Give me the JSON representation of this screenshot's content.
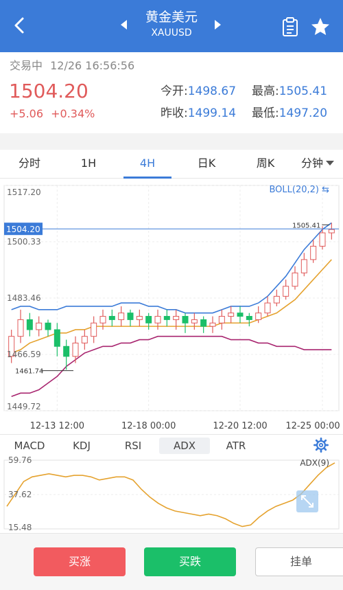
{
  "header": {
    "title": "黄金美元",
    "subtitle": "XAUUSD",
    "icons": [
      "back-icon",
      "prev-arrow-icon",
      "next-arrow-icon",
      "clipboard-icon",
      "star-icon"
    ]
  },
  "quote": {
    "status": "交易中",
    "datetime": "12/26 16:56:56",
    "price": "1504.20",
    "change": "+5.06",
    "change_pct": "+0.34%",
    "open_label": "今开:",
    "open": "1498.67",
    "high_label": "最高:",
    "high": "1505.41",
    "prev_close_label": "昨收:",
    "prev_close": "1499.14",
    "low_label": "最低:",
    "low": "1497.20"
  },
  "tabs": [
    "分时",
    "1H",
    "4H",
    "日K",
    "周K",
    "分钟"
  ],
  "active_tab": "4H",
  "indicator_tabs": [
    "MACD",
    "KDJ",
    "RSI",
    "ADX",
    "ATR"
  ],
  "active_indicator": "ADX",
  "buttons": {
    "buy_up": "买涨",
    "buy_down": "买跌",
    "order": "挂单"
  },
  "colors": {
    "brand": "#3b7bd8",
    "up": "#e05a5a",
    "down": "#1bbf69",
    "boll_mid": "#e5a22e",
    "boll_lower": "#a8256f"
  },
  "chart_data": [
    {
      "type": "candlestick",
      "indicator": "BOLL(20,2)",
      "y_ticks": [
        "1517.20",
        "1500.33",
        "1483.46",
        "1466.59",
        "1449.72"
      ],
      "ylim": [
        1449.72,
        1517.2
      ],
      "current_price_label": "1504.20",
      "high_marker": "1505.41",
      "low_marker": "1461.74",
      "x_ticks": [
        "12-13 12:00",
        "12-18 00:00",
        "12-20 12:00",
        "12-25 00:00"
      ],
      "candles": [
        [
          1466,
          1472,
          1464,
          1474
        ],
        [
          1472,
          1477,
          1470,
          1480
        ],
        [
          1477,
          1474,
          1472,
          1479
        ],
        [
          1474,
          1476,
          1472,
          1478
        ],
        [
          1476,
          1474,
          1472,
          1477
        ],
        [
          1474,
          1469,
          1466,
          1476
        ],
        [
          1469,
          1466,
          1462,
          1471
        ],
        [
          1466,
          1470,
          1464,
          1472
        ],
        [
          1470,
          1472,
          1468,
          1474
        ],
        [
          1472,
          1476,
          1470,
          1478
        ],
        [
          1476,
          1478,
          1474,
          1480
        ],
        [
          1478,
          1477,
          1475,
          1480
        ],
        [
          1477,
          1479,
          1475,
          1481
        ],
        [
          1479,
          1477,
          1475,
          1480
        ],
        [
          1477,
          1478,
          1475,
          1480
        ],
        [
          1478,
          1476,
          1474,
          1479
        ],
        [
          1476,
          1478,
          1474,
          1480
        ],
        [
          1478,
          1477,
          1475,
          1480
        ],
        [
          1477,
          1478,
          1474,
          1480
        ],
        [
          1478,
          1476,
          1473,
          1479
        ],
        [
          1476,
          1477,
          1474,
          1479
        ],
        [
          1477,
          1475,
          1473,
          1478
        ],
        [
          1475,
          1476,
          1473,
          1478
        ],
        [
          1476,
          1478,
          1474,
          1480
        ],
        [
          1478,
          1479,
          1476,
          1481
        ],
        [
          1479,
          1478,
          1476,
          1481
        ],
        [
          1478,
          1477,
          1475,
          1479
        ],
        [
          1477,
          1479,
          1476,
          1481
        ],
        [
          1479,
          1482,
          1478,
          1484
        ],
        [
          1482,
          1484,
          1481,
          1486
        ],
        [
          1484,
          1487,
          1483,
          1489
        ],
        [
          1487,
          1491,
          1486,
          1493
        ],
        [
          1491,
          1495,
          1490,
          1497
        ],
        [
          1495,
          1499,
          1494,
          1501
        ],
        [
          1499,
          1503,
          1498,
          1505
        ],
        [
          1503,
          1504,
          1501,
          1506
        ]
      ],
      "boll_upper": [
        1480,
        1481,
        1481,
        1480,
        1480,
        1480,
        1481,
        1481,
        1481,
        1481,
        1481,
        1481,
        1482,
        1482,
        1482,
        1481,
        1481,
        1480,
        1480,
        1479,
        1479,
        1479,
        1479,
        1480,
        1481,
        1481,
        1481,
        1482,
        1484,
        1487,
        1490,
        1494,
        1498,
        1501,
        1504,
        1506
      ],
      "boll_mid": [
        1467,
        1468,
        1470,
        1471,
        1472,
        1473,
        1473,
        1474,
        1474,
        1475,
        1475,
        1475,
        1475,
        1475,
        1475,
        1475,
        1475,
        1475,
        1475,
        1475,
        1475,
        1475,
        1475,
        1476,
        1476,
        1476,
        1476,
        1477,
        1478,
        1479,
        1481,
        1483,
        1486,
        1489,
        1492,
        1495
      ],
      "boll_lower": [
        1454,
        1455,
        1455,
        1456,
        1458,
        1460,
        1463,
        1465,
        1467,
        1468,
        1469,
        1469,
        1470,
        1470,
        1471,
        1471,
        1472,
        1472,
        1472,
        1472,
        1472,
        1472,
        1472,
        1472,
        1471,
        1471,
        1471,
        1470,
        1470,
        1469,
        1469,
        1469,
        1468,
        1468,
        1468,
        1468
      ]
    },
    {
      "type": "line",
      "name": "ADX(9)",
      "y_ticks": [
        "59.76",
        "37.62",
        "15.48"
      ],
      "ylim": [
        15.48,
        59.76
      ],
      "values": [
        30,
        38,
        46,
        49,
        50,
        51,
        50,
        49,
        50,
        50,
        49,
        47,
        48,
        49,
        49,
        47,
        41,
        36,
        32,
        29,
        27,
        26,
        25,
        24,
        25,
        24,
        22,
        19,
        17,
        18,
        23,
        27,
        30,
        32,
        34,
        38,
        44,
        50,
        55,
        58
      ]
    }
  ]
}
